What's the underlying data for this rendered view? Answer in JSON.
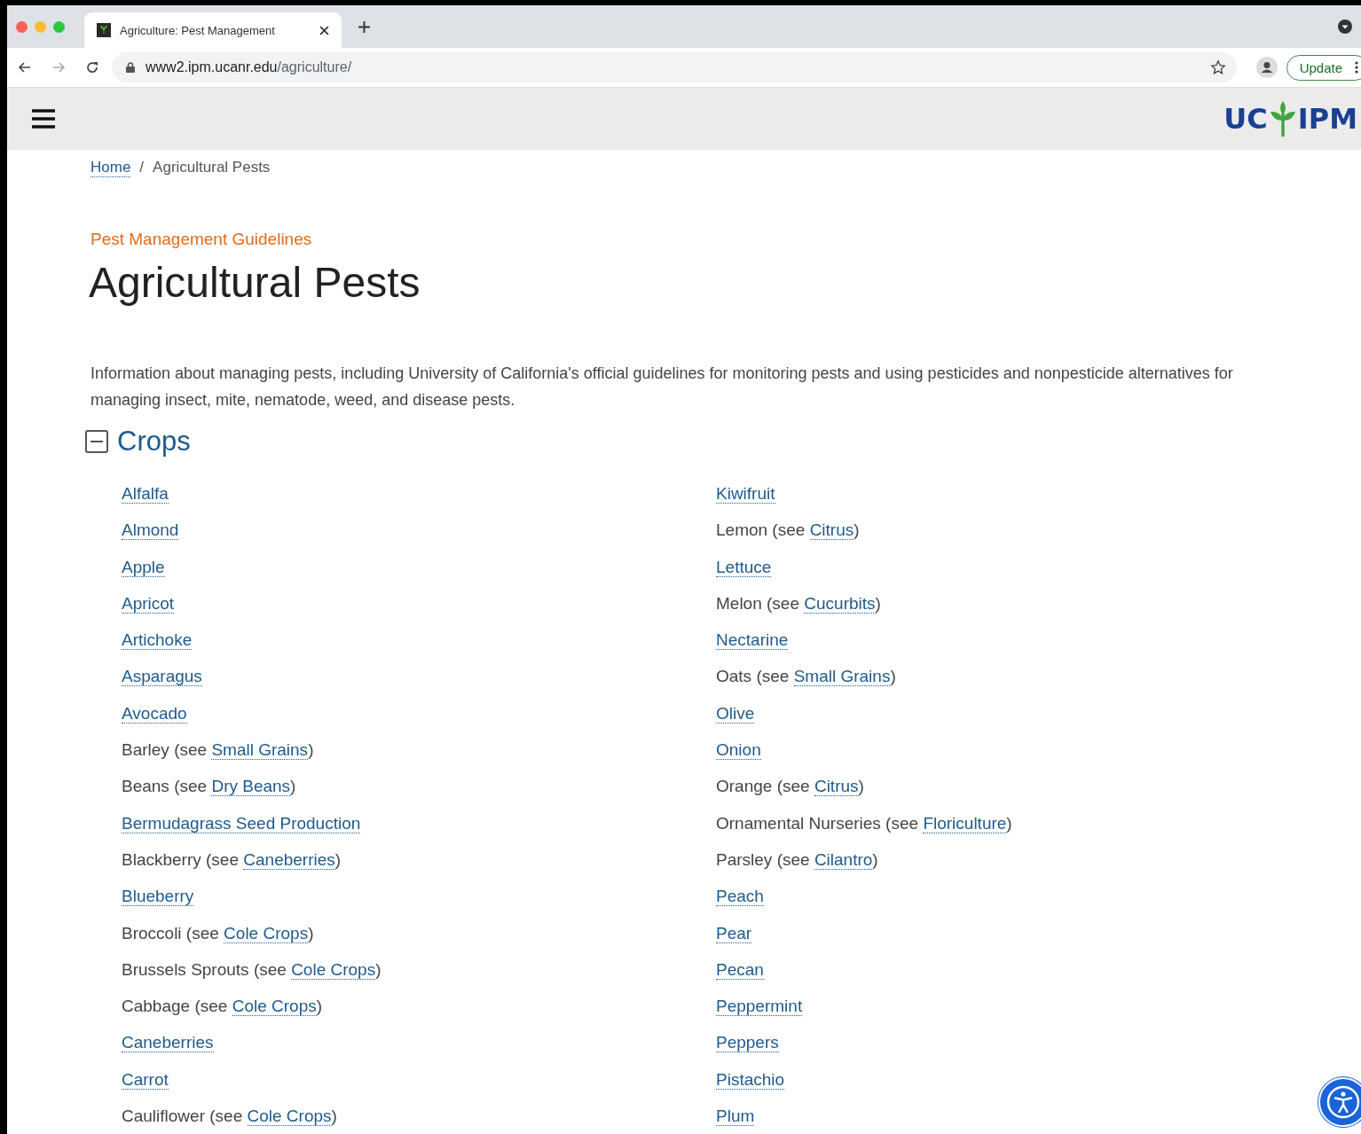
{
  "browser": {
    "tab_title": "Agriculture: Pest Management",
    "url_host": "www2.ipm.ucanr.edu",
    "url_path": "/agriculture/",
    "update_label": "Update"
  },
  "header": {
    "logo_left": "UC",
    "logo_right": "IPM"
  },
  "breadcrumb": [
    {
      "label": "Home",
      "kind": "link"
    },
    {
      "label": "/",
      "kind": "sep"
    },
    {
      "label": "Agricultural Pests",
      "kind": "current"
    }
  ],
  "eyebrow": "Pest Management Guidelines",
  "title": "Agricultural Pests",
  "intro": "Information about managing pests, including University of California's official guidelines for monitoring pests and using pesticides and nonpesticide alternatives for managing insect, mite, nematode, weed, and disease pests.",
  "section": {
    "title": "Crops",
    "expanded": true
  },
  "columns": [
    [
      {
        "kind": "link",
        "link": "Alfalfa"
      },
      {
        "kind": "link",
        "link": "Almond"
      },
      {
        "kind": "link",
        "link": "Apple"
      },
      {
        "kind": "link",
        "link": "Apricot"
      },
      {
        "kind": "link",
        "link": "Artichoke"
      },
      {
        "kind": "link",
        "link": "Asparagus"
      },
      {
        "kind": "link",
        "link": "Avocado"
      },
      {
        "kind": "see",
        "text": "Barley (see ",
        "link": "Small Grains",
        "close": ")"
      },
      {
        "kind": "see",
        "text": "Beans (see ",
        "link": "Dry Beans",
        "close": ")"
      },
      {
        "kind": "link",
        "link": "Bermudagrass Seed Production"
      },
      {
        "kind": "see",
        "text": "Blackberry (see ",
        "link": "Caneberries",
        "close": ")"
      },
      {
        "kind": "link",
        "link": "Blueberry"
      },
      {
        "kind": "see",
        "text": "Broccoli (see ",
        "link": "Cole Crops",
        "close": ")"
      },
      {
        "kind": "see",
        "text": "Brussels Sprouts (see ",
        "link": "Cole Crops",
        "close": ")"
      },
      {
        "kind": "see",
        "text": "Cabbage (see ",
        "link": "Cole Crops",
        "close": ")"
      },
      {
        "kind": "link",
        "link": "Caneberries"
      },
      {
        "kind": "link",
        "link": "Carrot"
      },
      {
        "kind": "see",
        "text": "Cauliflower (see ",
        "link": "Cole Crops",
        "close": ")"
      }
    ],
    [
      {
        "kind": "link",
        "link": "Kiwifruit"
      },
      {
        "kind": "see",
        "text": "Lemon (see ",
        "link": "Citrus",
        "close": ")"
      },
      {
        "kind": "link",
        "link": "Lettuce"
      },
      {
        "kind": "see",
        "text": "Melon (see ",
        "link": "Cucurbits",
        "close": ")"
      },
      {
        "kind": "link",
        "link": "Nectarine"
      },
      {
        "kind": "see",
        "text": "Oats (see ",
        "link": "Small Grains",
        "close": ")"
      },
      {
        "kind": "link",
        "link": "Olive"
      },
      {
        "kind": "link",
        "link": "Onion"
      },
      {
        "kind": "see",
        "text": "Orange (see ",
        "link": "Citrus",
        "close": ")"
      },
      {
        "kind": "see",
        "text": "Ornamental Nurseries (see ",
        "link": "Floriculture",
        "close": ")"
      },
      {
        "kind": "see",
        "text": "Parsley (see ",
        "link": "Cilantro",
        "close": ")"
      },
      {
        "kind": "link",
        "link": "Peach"
      },
      {
        "kind": "link",
        "link": "Pear"
      },
      {
        "kind": "link",
        "link": "Pecan"
      },
      {
        "kind": "link",
        "link": "Peppermint"
      },
      {
        "kind": "link",
        "link": "Peppers"
      },
      {
        "kind": "link",
        "link": "Pistachio"
      },
      {
        "kind": "link",
        "link": "Plum"
      }
    ]
  ]
}
